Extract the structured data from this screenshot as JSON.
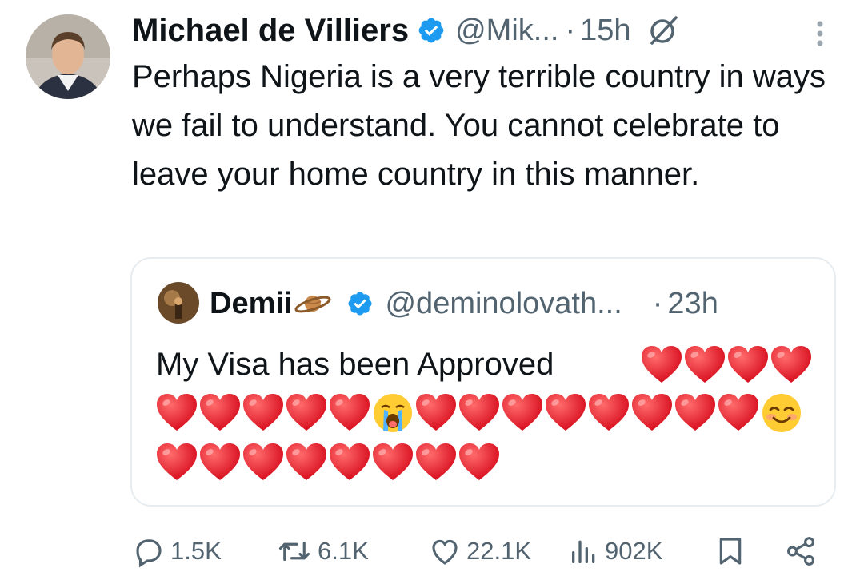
{
  "tweet": {
    "author_name": "Michael de Villiers",
    "handle": "@Mik...",
    "separator": "·",
    "time": "15h",
    "text": "Perhaps Nigeria is a very terrible country in ways we fail to understand. You cannot celebrate to leave your home country in this manner."
  },
  "quote": {
    "author_name": "Demii",
    "handle": "@deminolovath...",
    "separator": "·",
    "time": "23h",
    "text": "My Visa has been Approved",
    "emoji_line1": [
      "heart",
      "heart",
      "heart",
      "heart"
    ],
    "emoji_line2": [
      "heart",
      "heart",
      "heart",
      "heart",
      "heart",
      "crying-face",
      "heart",
      "heart",
      "heart",
      "heart",
      "heart",
      "heart",
      "heart",
      "heart",
      "smiling-face"
    ],
    "emoji_line3": [
      "heart",
      "heart",
      "heart",
      "heart",
      "heart",
      "heart",
      "heart",
      "heart"
    ]
  },
  "actions": {
    "replies": "1.5K",
    "reposts": "6.1K",
    "likes": "22.1K",
    "views": "902K"
  },
  "colors": {
    "text": "#0f1419",
    "secondary": "#536471",
    "verified": "#1d9bf0",
    "border": "#e6ecf0",
    "heart": "#e8182c"
  }
}
